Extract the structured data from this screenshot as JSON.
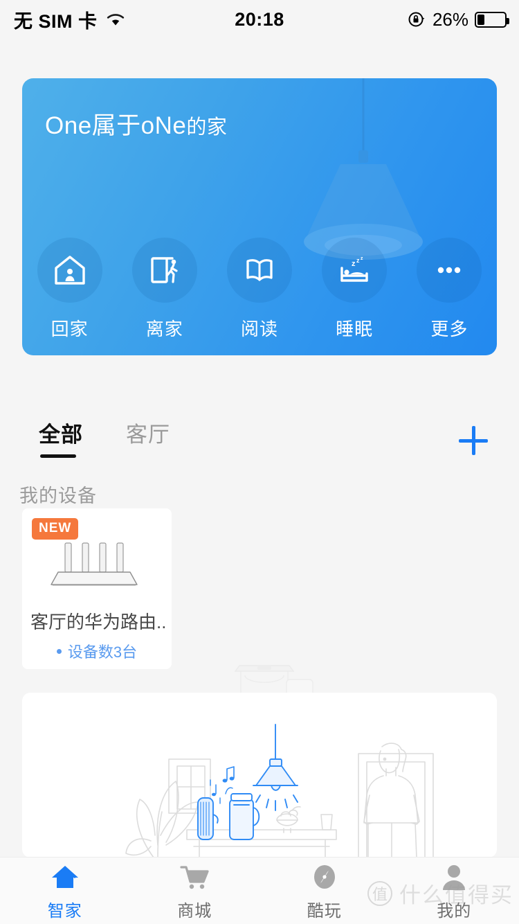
{
  "statusbar": {
    "carrier": "无 SIM 卡",
    "wifi_icon": "wifi-icon",
    "time": "20:18",
    "lock_icon": "rotation-lock-icon",
    "battery_text": "26%",
    "battery_percent": 26
  },
  "hero": {
    "title_main": "One属于oNe",
    "title_suffix": "的家",
    "decor_icon": "pendant-lamp-illustration",
    "gradient_from": "#4fb0ea",
    "gradient_to": "#2289ef",
    "scenes": [
      {
        "label": "回家",
        "icon": "home-person-icon"
      },
      {
        "label": "离家",
        "icon": "door-exit-icon"
      },
      {
        "label": "阅读",
        "icon": "open-book-icon"
      },
      {
        "label": "睡眠",
        "icon": "bed-sleep-icon"
      },
      {
        "label": "更多",
        "icon": "more-dots-icon"
      }
    ]
  },
  "tabs": {
    "items": [
      {
        "label": "全部",
        "active": true
      },
      {
        "label": "客厅",
        "active": false
      }
    ],
    "add_icon": "plus-icon",
    "accent": "#1a7cf5"
  },
  "devices": {
    "section_title": "我的设备",
    "items": [
      {
        "badge": "NEW",
        "badge_color": "#f5783c",
        "icon": "wifi-router-illustration",
        "name": "客厅的华为路由...",
        "status": "设备数3台",
        "status_color": "#5a9bef"
      }
    ]
  },
  "illustration": {
    "name": "smart-home-scene-illustration",
    "ghost_name": "appliance-ghost-illustration",
    "accent": "#2f8bf5"
  },
  "bottomnav": {
    "items": [
      {
        "label": "智家",
        "icon": "home-icon",
        "active": true
      },
      {
        "label": "商城",
        "icon": "shopping-cart-icon",
        "active": false
      },
      {
        "label": "酷玩",
        "icon": "compass-icon",
        "active": false
      },
      {
        "label": "我的",
        "icon": "person-icon",
        "active": false
      }
    ],
    "active_color": "#1a7cf5"
  },
  "watermark": {
    "mark": "值",
    "text": "什么值得买"
  }
}
